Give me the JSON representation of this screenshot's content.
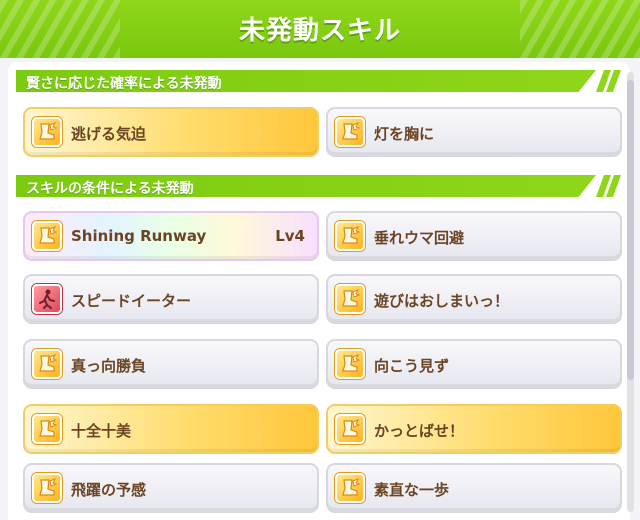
{
  "header": {
    "title": "未発動スキル"
  },
  "sections": [
    {
      "label": "賢さに応じた確率による未発動",
      "skills": [
        {
          "name": "逃げる気迫",
          "style": "gold",
          "icon": "winged-boot-icon"
        },
        {
          "name": "灯を胸に",
          "style": "gray",
          "icon": "winged-boot-icon"
        }
      ]
    },
    {
      "label": "スキルの条件による未発動",
      "skills": [
        {
          "name": "Shining Runway",
          "level": "Lv4",
          "style": "rainbow",
          "icon": "winged-boot-icon"
        },
        {
          "name": "垂れウマ回避",
          "style": "gray",
          "icon": "winged-boot-icon"
        },
        {
          "name": "スピードイーター",
          "style": "gray",
          "icon": "debuff-runner-icon"
        },
        {
          "name": "遊びはおしまいっ！",
          "style": "gray",
          "icon": "winged-boot-icon"
        },
        {
          "name": "真っ向勝負",
          "style": "gray",
          "icon": "winged-boot-icon"
        },
        {
          "name": "向こう見ず",
          "style": "gray",
          "icon": "winged-boot-icon"
        },
        {
          "name": "十全十美",
          "style": "gold",
          "icon": "winged-boot-icon"
        },
        {
          "name": "かっとばせ！",
          "style": "gold",
          "icon": "winged-boot-icon"
        },
        {
          "name": "飛躍の予感",
          "style": "gray",
          "icon": "winged-boot-icon"
        },
        {
          "name": "素直な一歩",
          "style": "gray",
          "icon": "winged-boot-icon"
        }
      ]
    }
  ],
  "colors": {
    "accent_green": "#8fd61a",
    "text_brown": "#6b4423",
    "gold_card": "#ffd65a",
    "gray_card": "#e6e6ef"
  }
}
